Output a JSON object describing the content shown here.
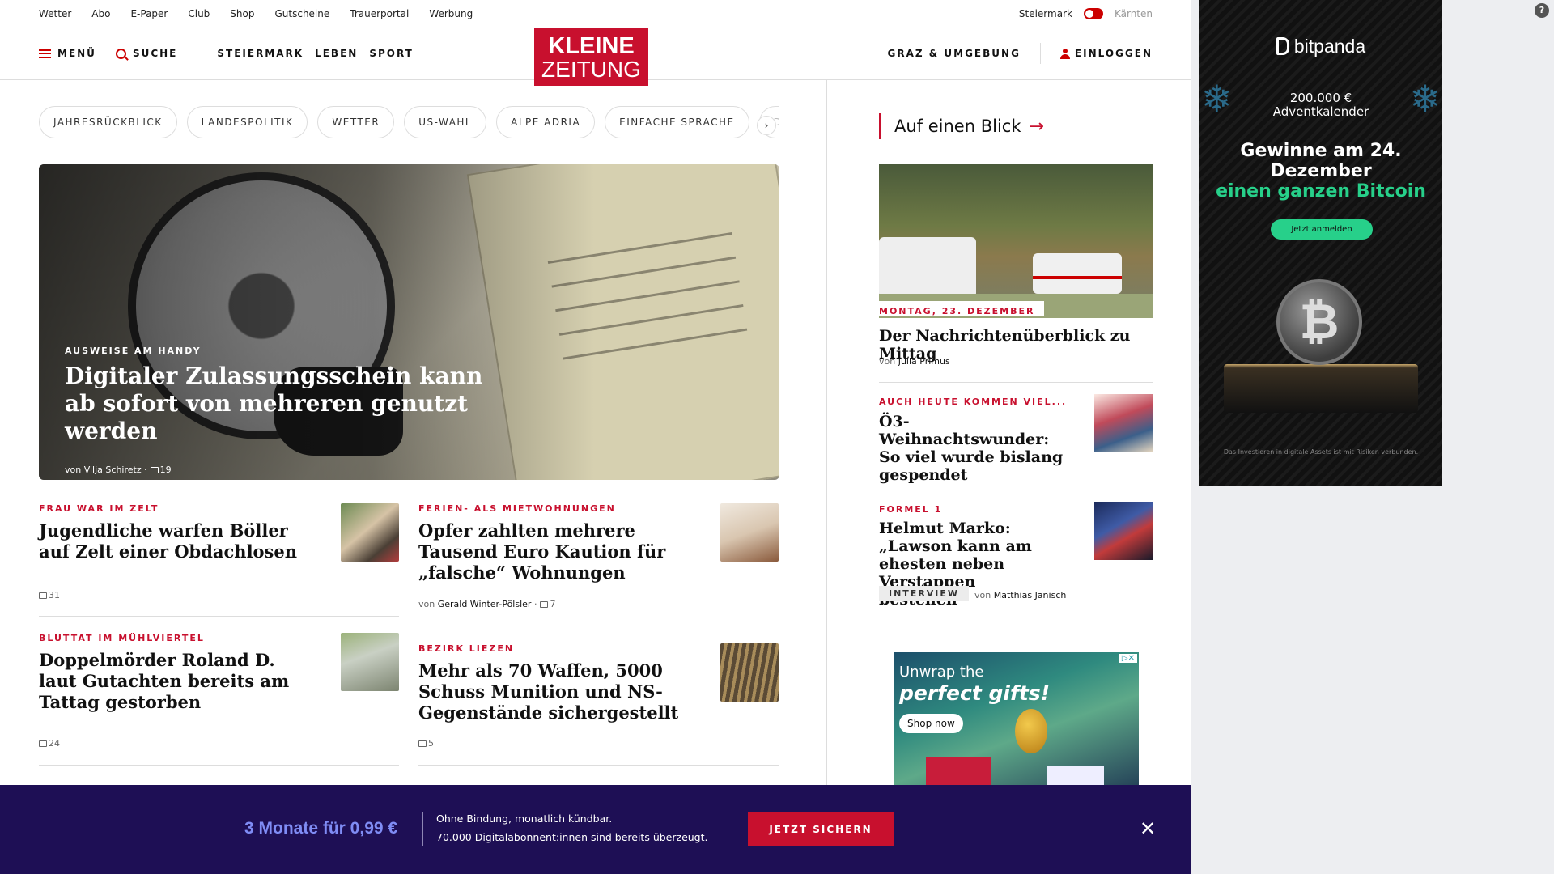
{
  "util_nav": [
    "Wetter",
    "Abo",
    "E-Paper",
    "Club",
    "Shop",
    "Gutscheine",
    "Trauerportal",
    "Werbung"
  ],
  "region": {
    "active": "Steiermark",
    "inactive": "Kärnten"
  },
  "header": {
    "menu": "MENÜ",
    "search": "SUCHE",
    "sections": [
      "STEIERMARK",
      "LEBEN",
      "SPORT"
    ],
    "logo_line1": "KLEINE",
    "logo_line2": "ZEITUNG",
    "local": "GRAZ & UMGEBUNG",
    "login": "EINLOGGEN"
  },
  "colors": {
    "brand": "#c8102e",
    "banner_bg": "#1e0f55",
    "offer": "#7f8cf5",
    "crypto_green": "#27d08a"
  },
  "topics": [
    "JAHRESRÜCKBLICK",
    "LANDESPOLITIK",
    "WETTER",
    "US-WAHL",
    "ALPE ADRIA",
    "EINFACHE SPRACHE",
    "DO"
  ],
  "hero": {
    "kicker": "AUSWEISE AM HANDY",
    "title": "Digitaler Zulassungsschein kann ab sofort von mehreren genutzt werden",
    "author_prefix": "von",
    "author": "Vilja Schiretz",
    "comments": "19"
  },
  "articles": [
    {
      "kicker": "FRAU WAR IM ZELT",
      "title": "Jugendliche warfen Böller auf Zelt einer Obdachlosen",
      "comments": "31"
    },
    {
      "kicker": "FERIEN- ALS MIETWOHNUNGEN",
      "title": "Opfer zahlten mehrere Tausend Euro Kaution für „falsche“ Wohnungen",
      "author": "Gerald Winter-Pölsler",
      "comments": "7"
    },
    {
      "kicker": "BLUTTAT IM MÜHLVIERTEL",
      "title": "Doppelmörder Roland D. laut Gutachten bereits am Tattag gestorben",
      "comments": "24"
    },
    {
      "kicker": "BEZIRK LIEZEN",
      "title": "Mehr als 70 Waffen, 5000 Schuss Munition und NS-Gegenstände sichergestellt",
      "comments": "5"
    }
  ],
  "sidebar": {
    "heading": "Auf einen Blick",
    "lead": {
      "date": "MONTAG, 23. DEZEMBER",
      "title": "Der Nachrichtenüberblick zu Mittag",
      "author": "Julia Primus"
    },
    "items": [
      {
        "kicker": "AUCH HEUTE KOMMEN VIEL...",
        "title": "Ö3-Weihnachtswunder: So viel wurde bislang gespendet"
      },
      {
        "kicker": "FORMEL 1",
        "title": "Helmut Marko: „Lawson kann am ehesten neben Verstappen bestehen“",
        "tag": "INTERVIEW",
        "author": "Matthias Janisch"
      }
    ],
    "ad": {
      "line1": "Unwrap the",
      "line2": "perfect gifts!",
      "cta": "Shop now"
    }
  },
  "bitpanda": {
    "brand": "bitpanda",
    "price": "200.000 €",
    "calendar": "Adventkalender",
    "head1": "Gewinne am 24.",
    "head2": "Dezember",
    "head3": "einen ganzen Bitcoin",
    "cta": "Jetzt anmelden",
    "disclaimer": "Das Investieren in digitale Assets ist mit Risiken verbunden."
  },
  "banner": {
    "offer": "3 Monate für 0,99 €",
    "line1": "Ohne Bindung, monatlich kündbar.",
    "line2": "70.000 Digitalabonnent:innen sind bereits überzeugt.",
    "cta": "JETZT SICHERN"
  },
  "common": {
    "by": "von"
  }
}
